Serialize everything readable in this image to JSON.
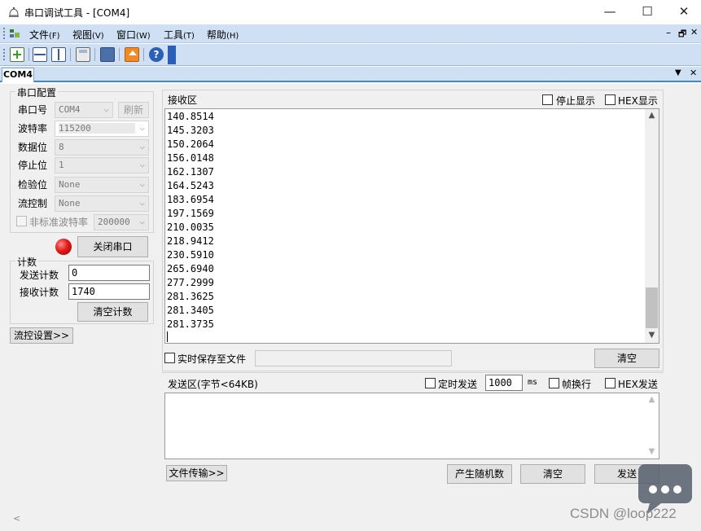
{
  "window": {
    "title": "串口调试工具 - [COM4]",
    "minimize_glyph": "—",
    "maximize_glyph": "☐",
    "close_glyph": "✕"
  },
  "menu": {
    "items": [
      {
        "label": "文件",
        "key": "(F)"
      },
      {
        "label": "视图",
        "key": "(V)"
      },
      {
        "label": "窗口",
        "key": "(W)"
      },
      {
        "label": "工具",
        "key": "(T)"
      },
      {
        "label": "帮助",
        "key": "(H)"
      }
    ],
    "mdi_min": "–",
    "mdi_restore": "🗗",
    "mdi_close": "✕"
  },
  "tabs": {
    "active": "COM4",
    "dropdown_glyph": "▼",
    "close_glyph": "✕"
  },
  "serial_config": {
    "group_title": "串口配置",
    "port_label": "串口号",
    "port_value": "COM4",
    "refresh_label": "刷新",
    "baud_label": "波特率",
    "baud_value": "115200",
    "databits_label": "数据位",
    "databits_value": "8",
    "stopbits_label": "停止位",
    "stopbits_value": "1",
    "parity_label": "检验位",
    "parity_value": "None",
    "flow_label": "流控制",
    "flow_value": "None",
    "nonstd_label": "非标准波特率",
    "nonstd_value": "200000",
    "close_port_label": "关闭串口",
    "led_color": "#e21a1a"
  },
  "counter": {
    "group_title": "计数",
    "sent_label": "发送计数",
    "sent_value": "0",
    "recv_label": "接收计数",
    "recv_value": "1740",
    "clear_label": "清空计数"
  },
  "flow_settings_label": "流控设置>>",
  "receive": {
    "title": "接收区",
    "stop_display_label": "停止显示",
    "hex_display_label": "HEX显示",
    "lines": [
      "140.8514",
      "145.3203",
      "150.2064",
      "156.0148",
      "162.1307",
      "164.5243",
      "183.6954",
      "197.1569",
      "210.0035",
      "218.9412",
      "230.5910",
      "265.6940",
      "277.2999",
      "281.3625",
      "281.3405",
      "281.3735"
    ],
    "save_file_label": "实时保存至文件",
    "clear_label": "清空"
  },
  "send": {
    "title": "发送区(字节<64KB)",
    "timed_send_label": "定时发送",
    "interval_value": "1000",
    "interval_unit": "ms",
    "newline_label": "帧换行",
    "hex_send_label": "HEX发送",
    "file_transfer_label": "文件传输>>",
    "random_label": "产生随机数",
    "clear_label": "清空",
    "send_label": "发送"
  },
  "watermark": "CSDN @loop222"
}
